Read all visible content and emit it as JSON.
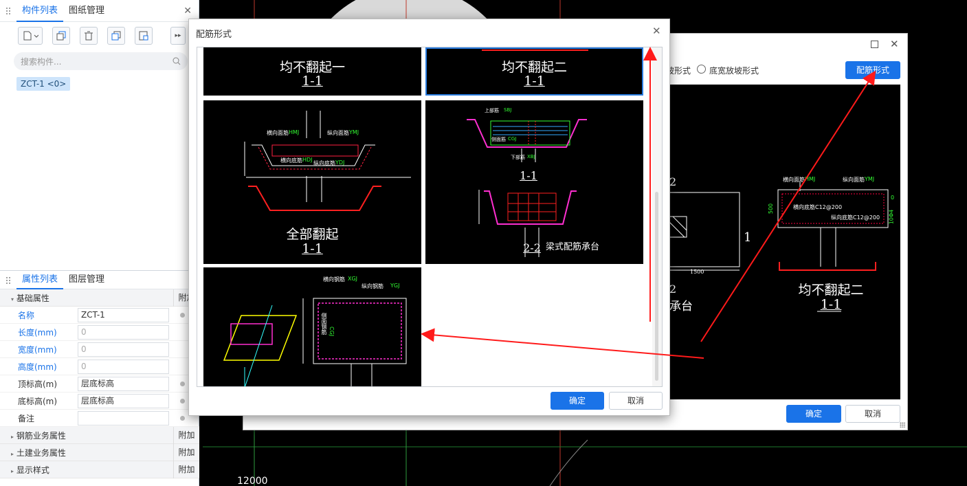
{
  "left_panel": {
    "tabs": [
      "构件列表",
      "图纸管理"
    ],
    "search_placeholder": "搜索构件...",
    "component": "ZCT-1 <0>",
    "prop_tabs": [
      "属性列表",
      "图层管理"
    ],
    "basic_group": "基础属性",
    "add_label": "附加",
    "props": [
      {
        "label": "名称",
        "value": "ZCT-1"
      },
      {
        "label": "长度(mm)",
        "value": "0"
      },
      {
        "label": "宽度(mm)",
        "value": "0"
      },
      {
        "label": "高度(mm)",
        "value": "0"
      },
      {
        "label": "顶标高(m)",
        "value": "层底标高"
      },
      {
        "label": "底标高(m)",
        "value": "层底标高"
      },
      {
        "label": "备注",
        "value": ""
      }
    ],
    "groups": [
      "钢筋业务属性",
      "土建业务属性",
      "显示样式"
    ]
  },
  "cad": {
    "dimension": "12000"
  },
  "back_dialog": {
    "radio1": "坡形式",
    "radio2": "底宽放坡形式",
    "reinf_button": "配筋形式",
    "ok": "确定",
    "cancel": "取消",
    "drawing": {
      "label_2": "2",
      "label_1": "1",
      "dim": "1500",
      "label_2b": "2",
      "label_cheng": "承台",
      "h_mj": "横向面筋",
      "h_mj_code": "HMJ",
      "z_mj": "纵向面筋",
      "z_mj_code": "YMJ",
      "h_dj": "横向底筋C12@200",
      "z_dj": "纵向底筋C12@200",
      "dim500": "500",
      "dim0": "0",
      "side": "10Φ4",
      "title": "均不翻起二",
      "sub": "1-1"
    }
  },
  "front_dialog": {
    "title": "配筋形式",
    "ok": "确定",
    "cancel": "取消",
    "cells": [
      {
        "title": "均不翻起一",
        "sub": "1-1"
      },
      {
        "title": "均不翻起二",
        "sub": "1-1"
      },
      {
        "title": "全部翻起",
        "sub": "1-1",
        "h_mj": "横向面筋",
        "h_mj_code": "HMJ",
        "z_mj": "纵向面筋",
        "z_mj_code": "YMJ",
        "h_dj": "横向底筋",
        "h_dj_code": "HDJ",
        "z_dj": "纵向底筋",
        "z_dj_code": "YDJ"
      },
      {
        "title": "梁式配筋承台",
        "sub1": "1-1",
        "sub2": "2-2",
        "top": "上部筋",
        "top_code": "SBJ",
        "bottom": "下部筋",
        "bottom_code": "XBJ",
        "side": "侧面筋",
        "side_code": "CGJ"
      },
      {
        "h_gj": "横向钢筋",
        "h_code": "XGJ",
        "z_gj": "纵向钢筋",
        "z_code": "YGJ",
        "side": "侧面钢筋",
        "side_code": "CGJ"
      }
    ]
  },
  "colors": {
    "accent": "#1a73e8",
    "arrow": "#ff1a1a"
  }
}
